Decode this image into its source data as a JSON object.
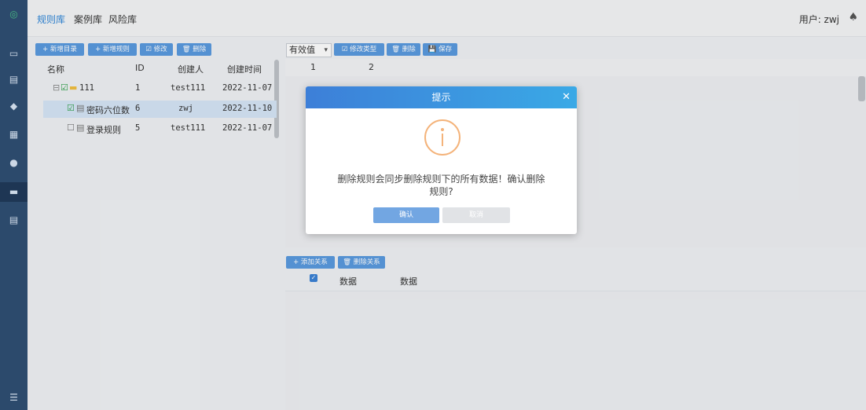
{
  "topnav": {
    "items": [
      "规则库",
      "案例库",
      "风险库"
    ],
    "user_label": "用户: zwj"
  },
  "left_toolbar": {
    "buttons": [
      "+ 新增目录",
      "+ 新增规则",
      "☑ 修改",
      "🗑 删除"
    ]
  },
  "tree_table": {
    "headers": [
      "名称",
      "ID",
      "创建人",
      "创建时间"
    ],
    "rows": [
      {
        "name": "111",
        "id": "1",
        "creator": "test111",
        "created": "2022-11-07"
      },
      {
        "name": "密码六位数",
        "id": "6",
        "creator": "zwj",
        "created": "2022-11-10"
      },
      {
        "name": "登录规则",
        "id": "5",
        "creator": "test111",
        "created": "2022-11-07"
      }
    ]
  },
  "right_toolbar": {
    "select_value": "有效值",
    "buttons": [
      "☑ 修改类型",
      "🗑 删除",
      "💾 保存"
    ]
  },
  "right_grid": {
    "headers": [
      "1",
      "2"
    ]
  },
  "relation_toolbar": {
    "buttons": [
      "+ 添加关系",
      "🗑 删除关系"
    ]
  },
  "relation_grid": {
    "headers": [
      "数据",
      "数据"
    ]
  },
  "dialog": {
    "title": "提示",
    "message": "删除规则会同步删除规则下的所有数据！确认删除规则?",
    "ok": "确认",
    "cancel": "取消"
  },
  "colors": {
    "rail": "#2f4f73",
    "accent": "#2f86d8",
    "button": "#5a9be0",
    "warning": "#f4b37a"
  }
}
